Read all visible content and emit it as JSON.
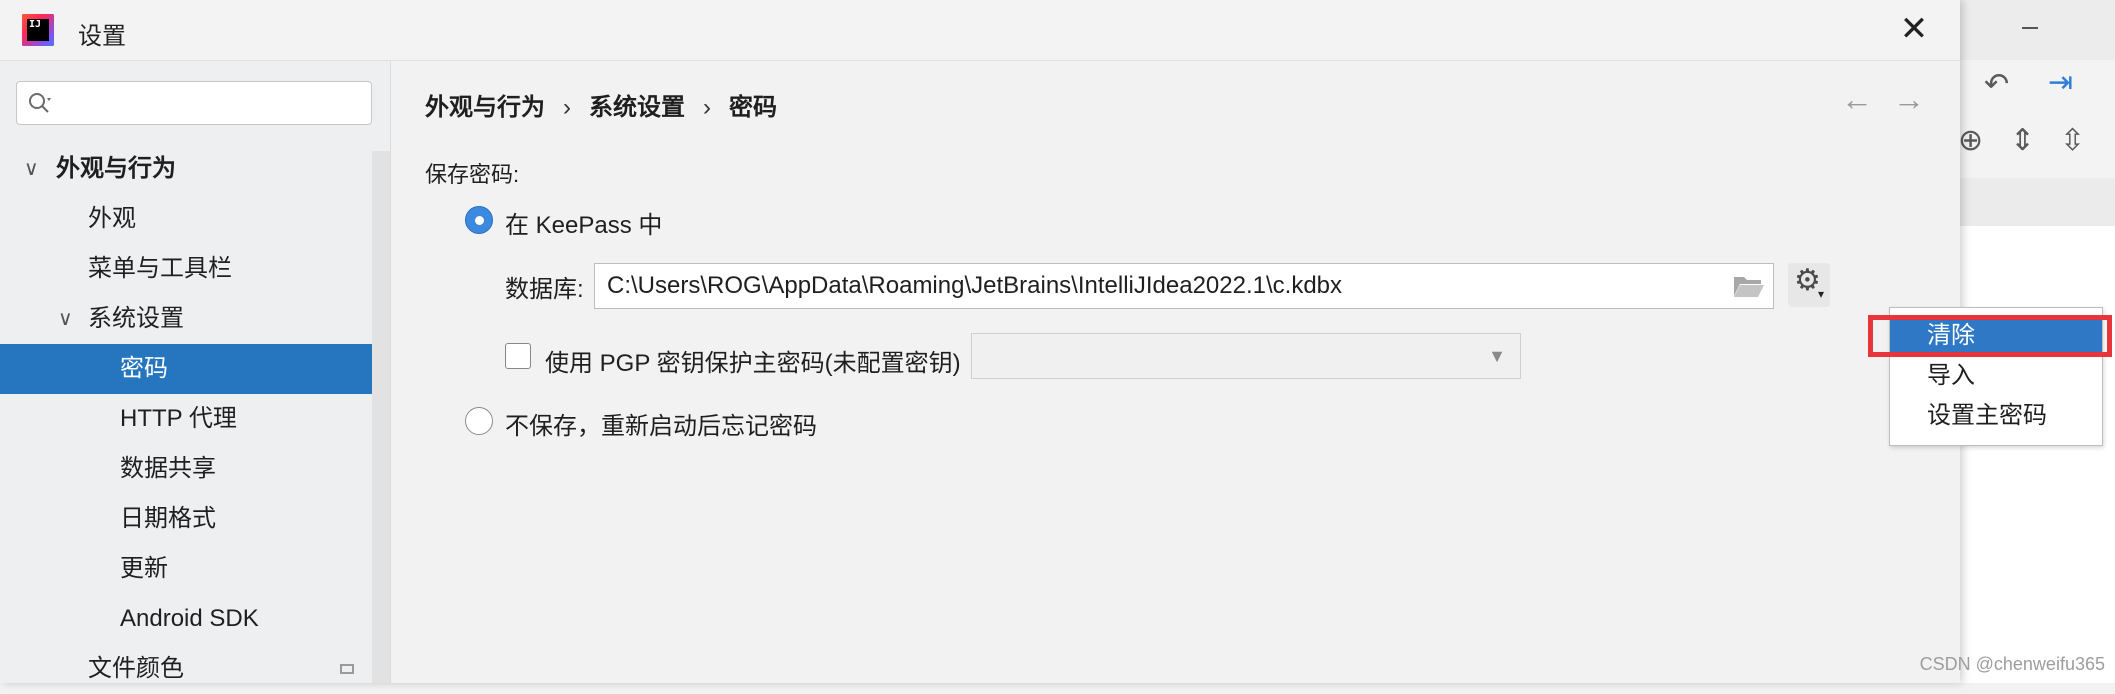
{
  "window": {
    "title": "设置",
    "app_icon_text": "IJ"
  },
  "search": {
    "placeholder": "",
    "value": ""
  },
  "sidebar": {
    "items": [
      {
        "label": "外观与行为",
        "level": 0,
        "expanded": true,
        "selected": false
      },
      {
        "label": "外观",
        "level": 1,
        "selected": false
      },
      {
        "label": "菜单与工具栏",
        "level": 1,
        "selected": false
      },
      {
        "label": "系统设置",
        "level": 1,
        "expanded": true,
        "selected": false
      },
      {
        "label": "密码",
        "level": 2,
        "selected": true
      },
      {
        "label": "HTTP 代理",
        "level": 2,
        "selected": false
      },
      {
        "label": "数据共享",
        "level": 2,
        "selected": false
      },
      {
        "label": "日期格式",
        "level": 2,
        "selected": false
      },
      {
        "label": "更新",
        "level": 2,
        "selected": false
      },
      {
        "label": "Android SDK",
        "level": 2,
        "selected": false
      },
      {
        "label": "文件颜色",
        "level": 1,
        "selected": false
      }
    ]
  },
  "breadcrumb": {
    "part1": "外观与行为",
    "part2": "系统设置",
    "part3": "密码",
    "separator": "›"
  },
  "nav": {
    "back": "←",
    "forward": "→"
  },
  "passwords": {
    "section_label": "保存密码:",
    "option_keepass": "在 KeePass 中",
    "option_keepass_selected": true,
    "database_label": "数据库:",
    "database_path": "C:\\Users\\ROG\\AppData\\Roaming\\JetBrains\\IntelliJIdea2022.1\\c.kdbx",
    "pgp_label": "使用 PGP 密钥保护主密码(未配置密钥)",
    "pgp_checked": false,
    "option_nosave": "不保存，重新启动后忘记密码",
    "option_nosave_selected": false
  },
  "gear_menu": {
    "items": [
      {
        "label": "清除",
        "selected": true
      },
      {
        "label": "导入",
        "selected": false
      },
      {
        "label": "设置主密码",
        "selected": false
      }
    ]
  },
  "watermark": "CSDN @chenweifu365",
  "colors": {
    "selection": "#2675bf",
    "highlight_border": "#e8343b",
    "radio_on": "#3b8ae0"
  }
}
